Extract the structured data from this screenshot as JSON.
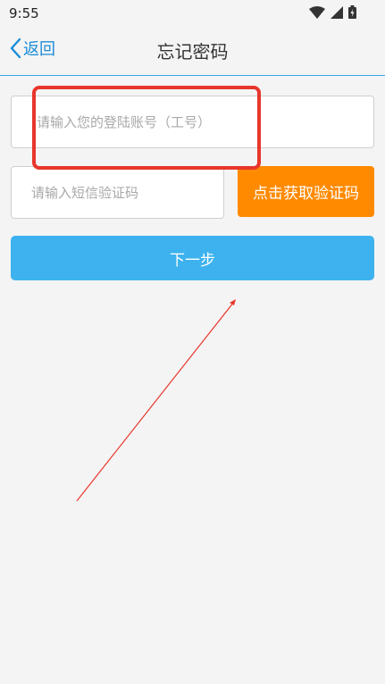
{
  "status_bar": {
    "time": "9:55"
  },
  "nav": {
    "back_label": "返回",
    "title": "忘记密码"
  },
  "form": {
    "account_placeholder": "请输入您的登陆账号（工号）",
    "sms_placeholder": "请输入短信验证码",
    "get_code_label": "点击获取验证码",
    "next_label": "下一步"
  },
  "colors": {
    "accent_blue": "#3db2ee",
    "code_button_orange": "#ff8a00",
    "annotation_red": "#e8362c"
  },
  "icons": [
    "wifi-icon",
    "signal-icon",
    "battery-icon",
    "chevron-left-icon"
  ]
}
